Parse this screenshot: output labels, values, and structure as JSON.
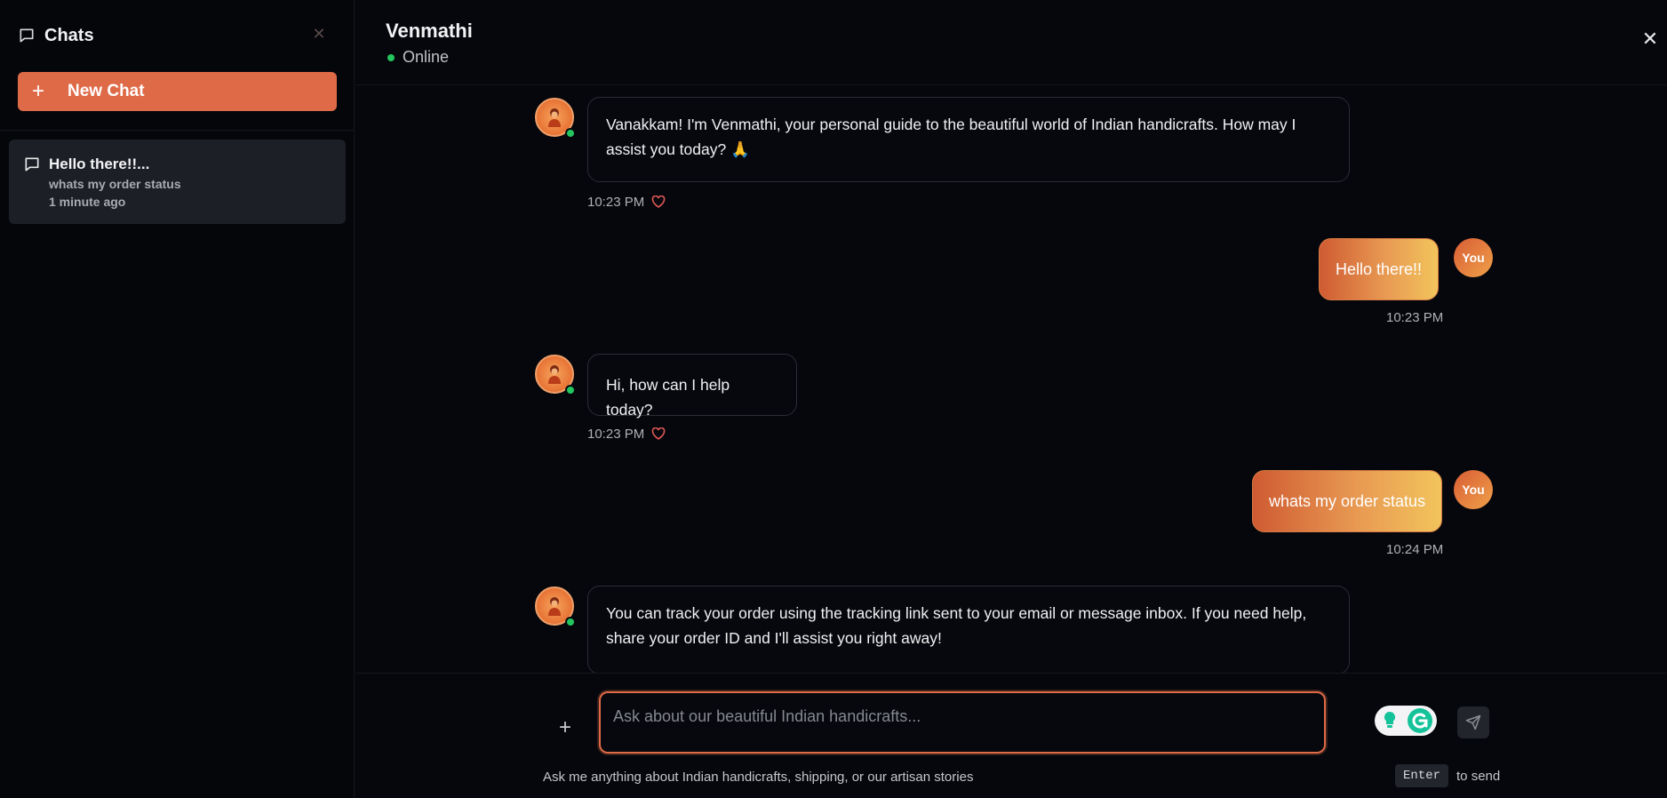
{
  "sidebar": {
    "title": "Chats",
    "new_chat_label": "New Chat",
    "chats": [
      {
        "title": "Hello there!!...",
        "preview": "whats my order status",
        "time": "1 minute ago"
      }
    ]
  },
  "header": {
    "name": "Venmathi",
    "status": "Online"
  },
  "messages": [
    {
      "from": "bot",
      "line1": "Vanakkam! I'm Venmathi, your personal guide to the beautiful world of Indian handicrafts. How may I",
      "line2": "assist you today? 🙏",
      "time": "10:23 PM"
    },
    {
      "from": "user",
      "text": "Hello there!!",
      "time": "10:23 PM",
      "avatar": "You"
    },
    {
      "from": "bot",
      "text": "Hi, how can I help today?",
      "time": "10:23 PM"
    },
    {
      "from": "user",
      "text": "whats my order status",
      "time": "10:24 PM",
      "avatar": "You"
    },
    {
      "from": "bot",
      "line1": "You can track your order using the tracking link sent to your email or message inbox. If you need help,",
      "line2": "share your order ID and I'll assist you right away!"
    }
  ],
  "composer": {
    "placeholder": "Ask about our beautiful Indian handicrafts...",
    "value": "",
    "hint": "Ask me anything about Indian handicrafts, shipping, or our artisan stories",
    "key": "Enter",
    "key_suffix": "to send"
  },
  "colors": {
    "accent": "#df6a47",
    "online": "#22c55e",
    "background": "#05070c"
  }
}
